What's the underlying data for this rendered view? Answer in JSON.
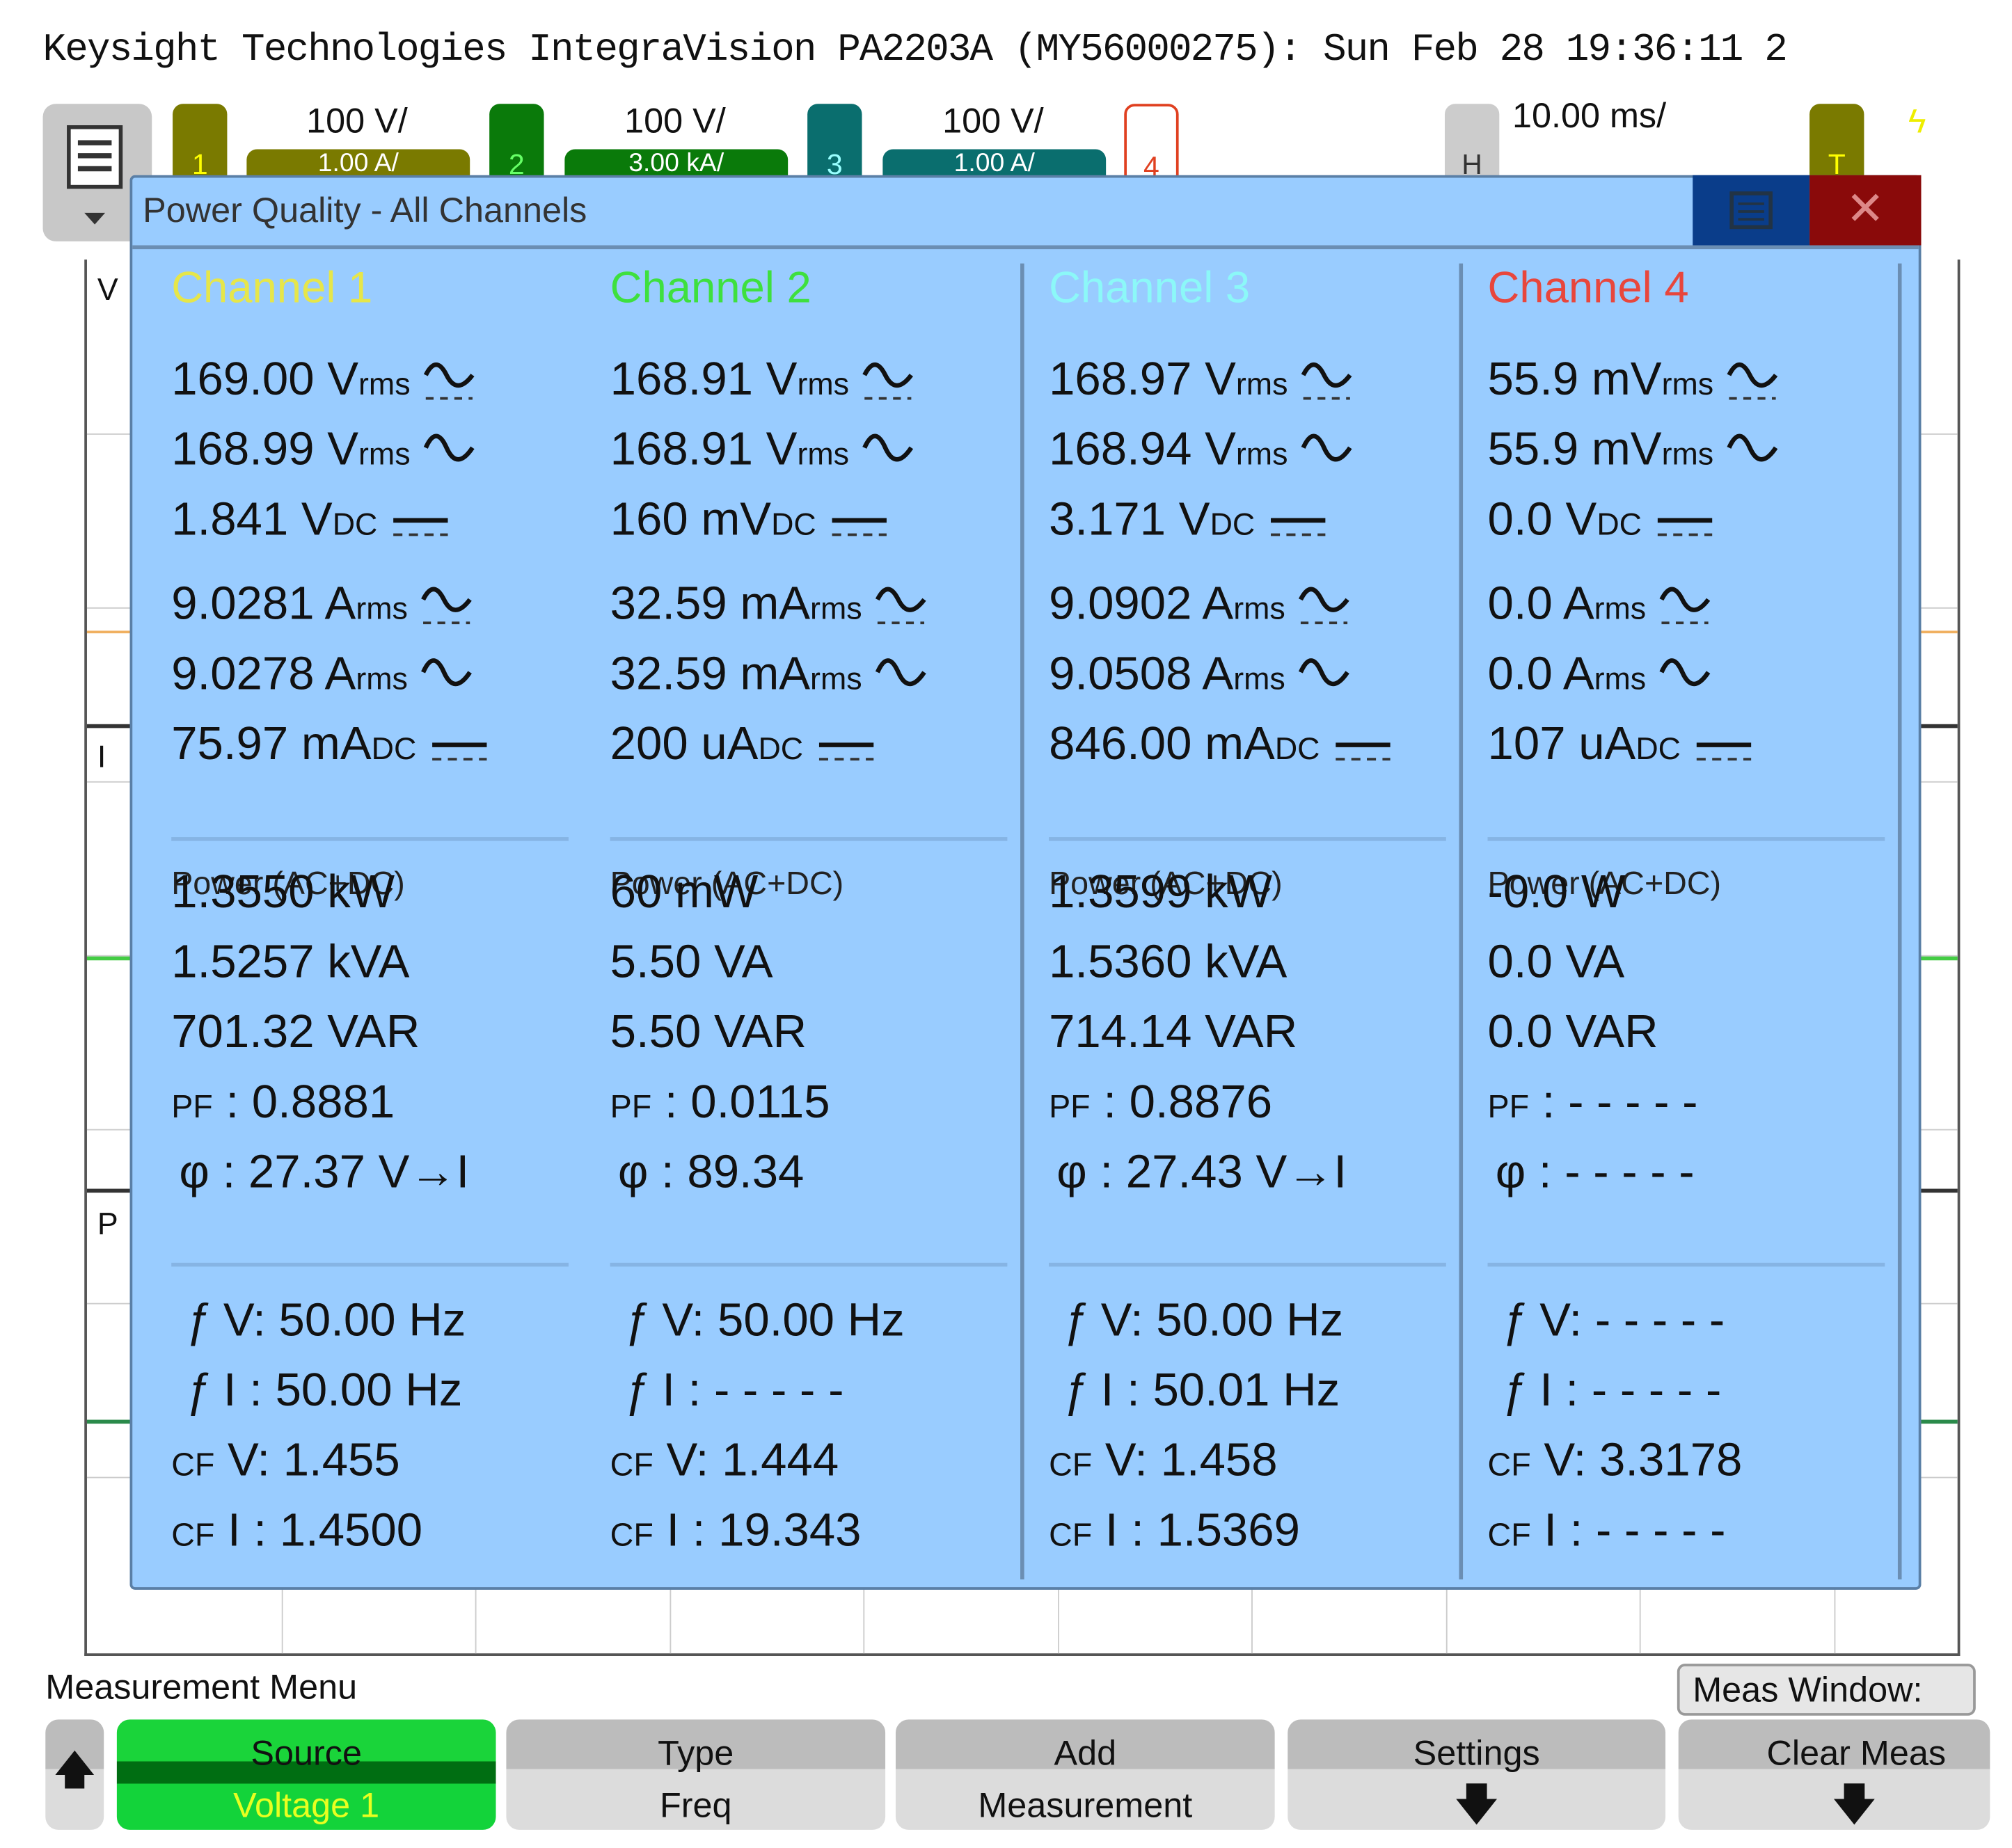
{
  "header": {
    "title": "Keysight Technologies IntegraVision PA2203A (MY56000275): Sun Feb 28 19:36:11 2"
  },
  "channel_bar": {
    "ch1": {
      "num": "1",
      "v_scale": "100 V/",
      "i_scale": "1.00 A/",
      "color": "#7a7a00"
    },
    "ch2": {
      "num": "2",
      "v_scale": "100 V/",
      "i_scale": "3.00 kA/",
      "color": "#0a7a0a"
    },
    "ch3": {
      "num": "3",
      "v_scale": "100 V/",
      "i_scale": "1.00 A/",
      "color": "#0a6e6e"
    },
    "ch4": {
      "num": "4",
      "color": "#e04020"
    },
    "horizontal": {
      "label": "H",
      "scale": "10.00 ms/"
    },
    "trigger": {
      "label": "T"
    }
  },
  "dialog": {
    "title": "Power Quality - All Channels",
    "close_icon": "close-icon",
    "menu_icon": "menu-icon",
    "power_label": "Power (AC+DC)",
    "pf_label": "PF",
    "phase_label": "φ",
    "fv_label": "V:",
    "fi_label": "I :",
    "cfv_label": "V:",
    "cfi_label": "I :",
    "f_symbol": "ƒ",
    "cf_symbol": "CF",
    "channels": [
      {
        "name": "Channel 1",
        "color": "#e6e64a",
        "meas": [
          {
            "value": "169.00 V",
            "suffix": "rms",
            "coupling": "acdc"
          },
          {
            "value": "168.99 V",
            "suffix": "rms",
            "coupling": "ac"
          },
          {
            "value": "1.841 V",
            "suffix": "DC",
            "coupling": "dc"
          },
          {
            "value": "9.0281 A",
            "suffix": "rms",
            "coupling": "acdc"
          },
          {
            "value": "9.0278 A",
            "suffix": "rms",
            "coupling": "ac"
          },
          {
            "value": "75.97 mA",
            "suffix": "DC",
            "coupling": "dc"
          }
        ],
        "power": [
          "1.3550 kW",
          "1.5257 kVA",
          "701.32 VAR"
        ],
        "pf": "0.8881",
        "phase": "27.37  V→I",
        "fv": "50.00 Hz",
        "fi": "50.00 Hz",
        "cfv": "1.455",
        "cfi": "1.4500"
      },
      {
        "name": "Channel 2",
        "color": "#3ee03e",
        "meas": [
          {
            "value": "168.91 V",
            "suffix": "rms",
            "coupling": "acdc"
          },
          {
            "value": "168.91 V",
            "suffix": "rms",
            "coupling": "ac"
          },
          {
            "value": "160 mV",
            "suffix": "DC",
            "coupling": "dc"
          },
          {
            "value": "32.59 mA",
            "suffix": "rms",
            "coupling": "acdc"
          },
          {
            "value": "32.59 mA",
            "suffix": "rms",
            "coupling": "ac"
          },
          {
            "value": "200 uA",
            "suffix": "DC",
            "coupling": "dc"
          }
        ],
        "power": [
          "60 mW",
          "5.50 VA",
          "5.50 VAR"
        ],
        "pf": "0.0115",
        "phase": "89.34",
        "fv": "50.00 Hz",
        "fi": "- - - - -",
        "cfv": "1.444",
        "cfi": "19.343"
      },
      {
        "name": "Channel 3",
        "color": "#8cf8f8",
        "meas": [
          {
            "value": "168.97 V",
            "suffix": "rms",
            "coupling": "acdc"
          },
          {
            "value": "168.94 V",
            "suffix": "rms",
            "coupling": "ac"
          },
          {
            "value": "3.171 V",
            "suffix": "DC",
            "coupling": "dc"
          },
          {
            "value": "9.0902 A",
            "suffix": "rms",
            "coupling": "acdc"
          },
          {
            "value": "9.0508 A",
            "suffix": "rms",
            "coupling": "ac"
          },
          {
            "value": "846.00 mA",
            "suffix": "DC",
            "coupling": "dc"
          }
        ],
        "power": [
          "1.3599 kW",
          "1.5360 kVA",
          "714.14 VAR"
        ],
        "pf": "0.8876",
        "phase": "27.43  V→I",
        "fv": "50.00 Hz",
        "fi": "50.01 Hz",
        "cfv": "1.458",
        "cfi": "1.5369"
      },
      {
        "name": "Channel 4",
        "color": "#e8463c",
        "meas": [
          {
            "value": "55.9 mV",
            "suffix": "rms",
            "coupling": "acdc"
          },
          {
            "value": "55.9 mV",
            "suffix": "rms",
            "coupling": "ac"
          },
          {
            "value": "0.0 V",
            "suffix": "DC",
            "coupling": "dc"
          },
          {
            "value": "0.0 A",
            "suffix": "rms",
            "coupling": "acdc"
          },
          {
            "value": "0.0 A",
            "suffix": "rms",
            "coupling": "ac"
          },
          {
            "value": "107 uA",
            "suffix": "DC",
            "coupling": "dc"
          }
        ],
        "power": [
          "-0.0 W",
          "0.0 VA",
          "0.0 VAR"
        ],
        "pf": "- - - - -",
        "phase": "- - - - -",
        "fv": "- - - - -",
        "fi": "- - - - -",
        "cfv": "3.3178",
        "cfi": "- - - - -"
      }
    ]
  },
  "waveform_labels": {
    "v": "V",
    "i": "I",
    "p": "P"
  },
  "bottom": {
    "menu_label": "Measurement Menu",
    "meas_window": "Meas Window:",
    "softkeys": {
      "source": {
        "top": "Source",
        "bottom": "Voltage 1"
      },
      "type": {
        "top": "Type",
        "bottom": "Freq"
      },
      "add": {
        "top": "Add",
        "bottom": "Measurement"
      },
      "settings": {
        "top": "Settings"
      },
      "clear": {
        "top": "Clear Meas"
      }
    },
    "active_color": "#1ad43a"
  }
}
